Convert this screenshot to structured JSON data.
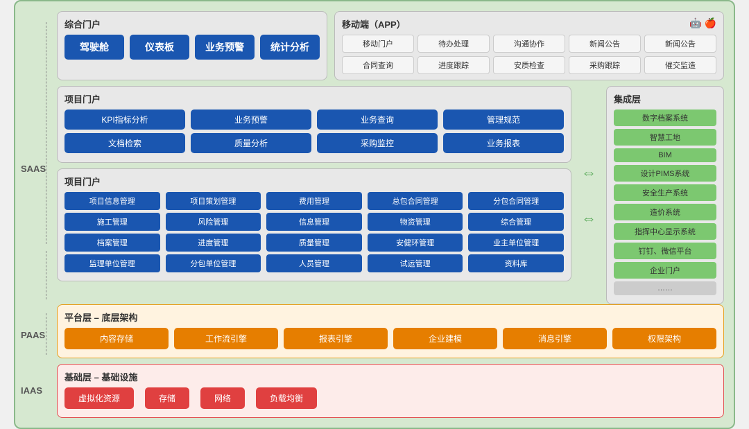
{
  "labels": {
    "saas": "SAAS",
    "paas": "PAAS",
    "iaas": "IAAS"
  },
  "zhumen": {
    "title": "综合门户",
    "buttons": [
      "驾驶舱",
      "仪表板",
      "业务预警",
      "统计分析"
    ]
  },
  "mobile": {
    "title": "移动端（APP）",
    "items": [
      "移动门户",
      "待办处理",
      "沟通协作",
      "新闻公告",
      "新闻公告",
      "合同查询",
      "进度跟踪",
      "安质检查",
      "采购跟踪",
      "催交监造"
    ]
  },
  "project_portal": {
    "title": "项目门户",
    "rows": [
      [
        "KPI指标分析",
        "业务预警",
        "业务查询",
        "管理规范"
      ],
      [
        "文档检索",
        "质量分析",
        "采购监控",
        "业务报表"
      ]
    ]
  },
  "project_mgmt": {
    "title": "项目门户",
    "rows": [
      [
        "项目信息管理",
        "项目策划管理",
        "费用管理",
        "总包合同管理",
        "分包合同管理"
      ],
      [
        "施工管理",
        "风险管理",
        "信息管理",
        "物资管理",
        "综合管理"
      ],
      [
        "档案管理",
        "进度管理",
        "质量管理",
        "安健环管理",
        "业主单位管理"
      ],
      [
        "监理单位管理",
        "分包单位管理",
        "人员管理",
        "试运管理",
        "资料库"
      ]
    ]
  },
  "integration": {
    "title": "集成层",
    "items": [
      "数字档案系统",
      "智慧工地",
      "BIM",
      "设计PIMS系统",
      "安全生产系统",
      "造价系统",
      "指挥中心显示系统",
      "钉钉、微信平台",
      "企业门户",
      "……"
    ]
  },
  "paas": {
    "title": "平台层 – 底层架构",
    "buttons": [
      "内容存储",
      "工作流引擎",
      "报表引擎",
      "企业建模",
      "消息引擎",
      "权限架构"
    ]
  },
  "iaas": {
    "title": "基础层 – 基础设施",
    "buttons": [
      "虚拟化资源",
      "存储",
      "网络",
      "负载均衡"
    ]
  }
}
